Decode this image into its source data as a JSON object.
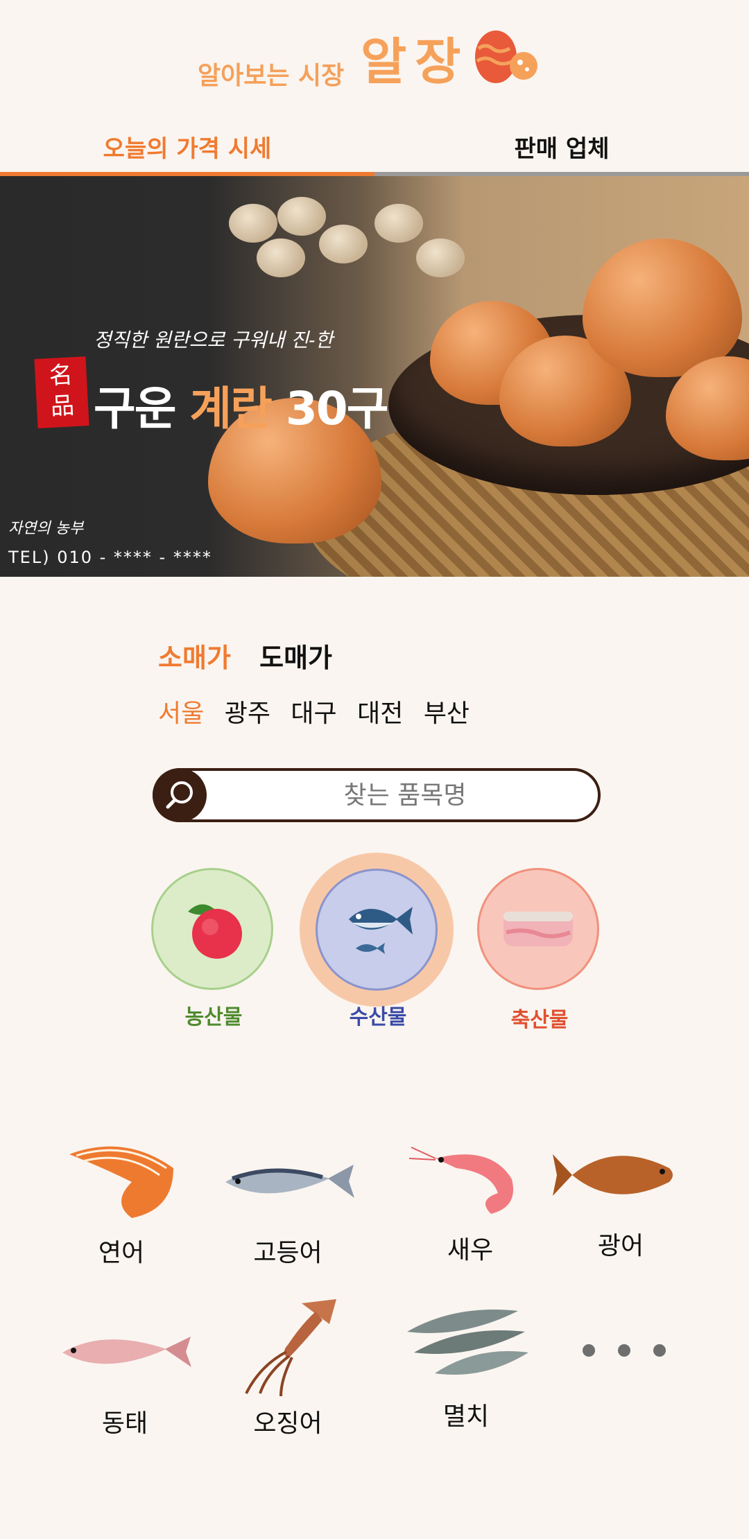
{
  "header": {
    "brand_sub": "알아보는 시장",
    "brand_main": "알장"
  },
  "tabs": [
    {
      "label": "오늘의 가격 시세",
      "active": true
    },
    {
      "label": "판매 업체",
      "active": false
    }
  ],
  "banner": {
    "tagline": "정직한 원란으로 구워내 진-한",
    "seal_text": "名品",
    "title_pre": "구운 ",
    "title_highlight": "계란",
    "title_post": " 30구",
    "farm": "자연의 농부",
    "tel": "TEL) 010 - **** - ****"
  },
  "price_type": {
    "options": [
      "소매가",
      "도매가"
    ],
    "selected": "소매가"
  },
  "regions": {
    "options": [
      "서울",
      "광주",
      "대구",
      "대전",
      "부산"
    ],
    "selected": "서울"
  },
  "search": {
    "placeholder": "찾는 품목명"
  },
  "categories": [
    {
      "label": "농산물",
      "color": "#4f8a2e"
    },
    {
      "label": "수산물",
      "color": "#3b4aa8",
      "selected": true
    },
    {
      "label": "축산물",
      "color": "#e0502f"
    }
  ],
  "items": [
    {
      "label": "연어",
      "icon": "salmon-icon"
    },
    {
      "label": "고등어",
      "icon": "mackerel-icon"
    },
    {
      "label": "새우",
      "icon": "shrimp-icon"
    },
    {
      "label": "광어",
      "icon": "flatfish-icon"
    },
    {
      "label": "동태",
      "icon": "pollack-icon"
    },
    {
      "label": "오징어",
      "icon": "squid-icon"
    },
    {
      "label": "멸치",
      "icon": "anchovy-icon"
    }
  ],
  "colors": {
    "accent": "#f07a30",
    "background": "#faf5f0",
    "dark_brown": "#3b1f12"
  }
}
